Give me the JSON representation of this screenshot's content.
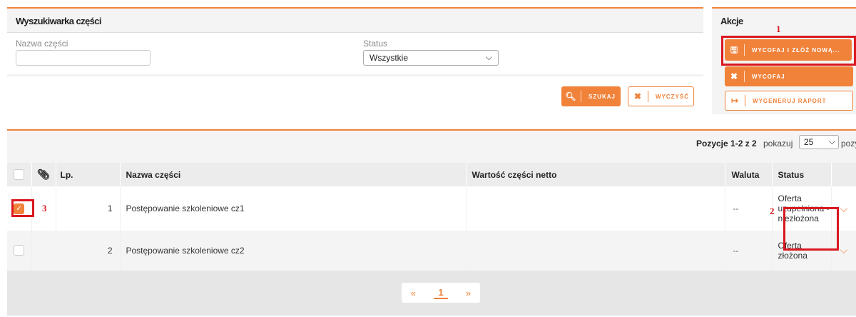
{
  "search": {
    "title": "Wyszukiwarka części",
    "name_label": "Nazwa części",
    "name_value": "",
    "status_label": "Status",
    "status_value": "Wszystkie",
    "search_btn": "SZUKAJ",
    "clear_btn": "WYCZYŚĆ"
  },
  "actions": {
    "title": "Akcje",
    "withdraw_resubmit": "WYCOFAJ I ZŁÓŻ NOWĄ...",
    "withdraw": "WYCOFAJ",
    "report": "WYGENERUJ RAPORT"
  },
  "annotations": [
    "1",
    "2",
    "3"
  ],
  "pagination": {
    "range_text": "Pozycje 1-2 z 2",
    "show_label": "pokazuj",
    "page_size": "25",
    "items_label": "pozycji",
    "prev": "«",
    "current": "1",
    "next": "»"
  },
  "table": {
    "headers": {
      "lp": "Lp.",
      "name": "Nazwa części",
      "value": "Wartość części netto",
      "currency": "Waluta",
      "status": "Status"
    },
    "rows": [
      {
        "lp": "1",
        "name": "Postępowanie szkoleniowe cz1",
        "value": "",
        "currency": "--",
        "status": "Oferta uzupełniona - niezłożona",
        "checked": true
      },
      {
        "lp": "2",
        "name": "Postępowanie szkoleniowe cz2",
        "value": "",
        "currency": "--",
        "status": "Oferta złożona",
        "checked": false
      }
    ]
  },
  "colors": {
    "accent": "#f0823a",
    "annotation": "#d9181f"
  }
}
